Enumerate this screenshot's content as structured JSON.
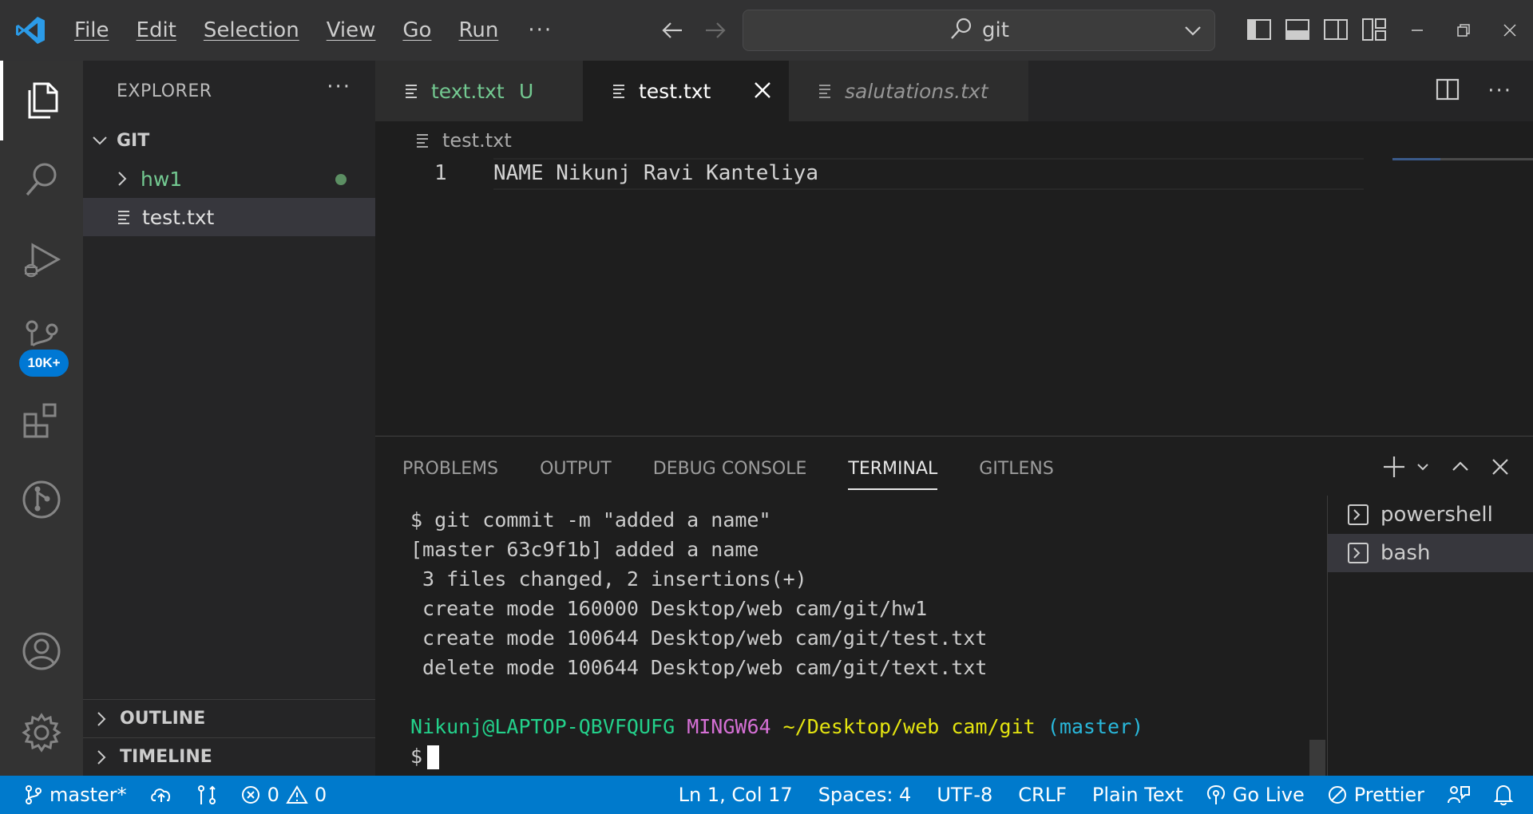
{
  "titlebar": {
    "menu": [
      "File",
      "Edit",
      "Selection",
      "View",
      "Go",
      "Run"
    ],
    "more": "···",
    "search_text": "git"
  },
  "activity": {
    "scm_badge": "10K+"
  },
  "sidebar": {
    "title": "EXPLORER",
    "more": "···",
    "root": "GIT",
    "items": [
      {
        "label": "hw1",
        "kind": "folder"
      },
      {
        "label": "test.txt",
        "kind": "file"
      }
    ],
    "outline": "OUTLINE",
    "timeline": "TIMELINE"
  },
  "tabs": [
    {
      "label": "text.txt",
      "badge": "U"
    },
    {
      "label": "test.txt"
    },
    {
      "label": "salutations.txt"
    }
  ],
  "editor": {
    "breadcrumb": "test.txt",
    "line_number": "1",
    "line_text": "NAME Nikunj Ravi Kanteliya"
  },
  "panel": {
    "tabs": [
      "PROBLEMS",
      "OUTPUT",
      "DEBUG CONSOLE",
      "TERMINAL",
      "GITLENS"
    ],
    "active_tab": "TERMINAL",
    "terminal_lines": [
      "$ git commit -m \"added a name\"",
      "[master 63c9f1b] added a name",
      " 3 files changed, 2 insertions(+)",
      " create mode 160000 Desktop/web cam/git/hw1",
      " create mode 100644 Desktop/web cam/git/test.txt",
      " delete mode 100644 Desktop/web cam/git/text.txt"
    ],
    "prompt_user": "Nikunj@LAPTOP-QBVFQUFG",
    "prompt_env": "MINGW64",
    "prompt_path": "~/Desktop/web cam/git",
    "prompt_branch": "(master)",
    "prompt_symbol": "$",
    "terminals": [
      "powershell",
      "bash"
    ]
  },
  "statusbar": {
    "branch": "master*",
    "errors": "0",
    "warnings": "0",
    "position": "Ln 1, Col 17",
    "spaces": "Spaces: 4",
    "encoding": "UTF-8",
    "eol": "CRLF",
    "language": "Plain Text",
    "golive": "Go Live",
    "prettier": "Prettier"
  },
  "colors": {
    "accent": "#007acc",
    "untracked": "#73c991",
    "terminal_green": "#23d18b",
    "terminal_magenta": "#d670d6",
    "terminal_yellow": "#e5e510",
    "terminal_cyan": "#29b8db"
  }
}
